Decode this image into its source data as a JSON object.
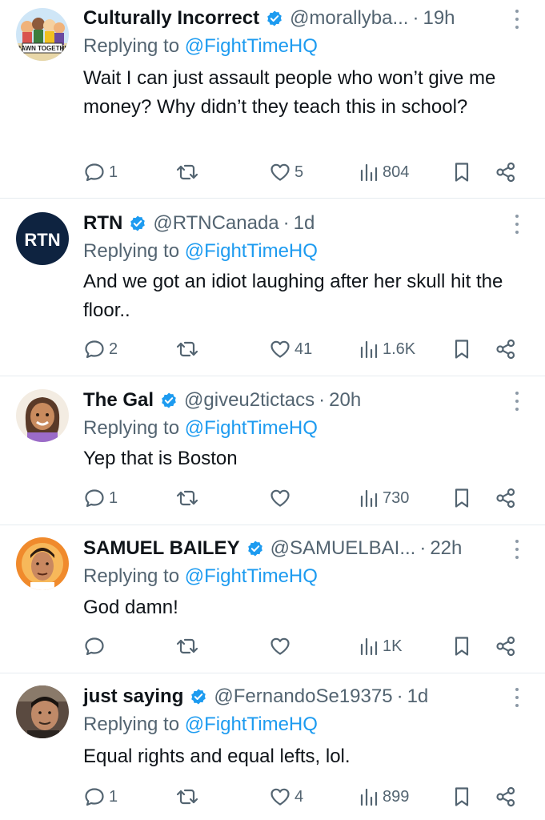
{
  "replies": [
    {
      "name": "Culturally Incorrect",
      "handle": "@morallyba...",
      "time": "19h",
      "replying_prefix": "Replying to ",
      "replying_to": "@FightTimeHQ",
      "text": "Wait I can just assault people who won’t give me money? Why didn’t they teach this in school?",
      "counts": {
        "replies": "1",
        "reposts": "",
        "likes": "5",
        "views": "804"
      },
      "avatar_text": "DRAWN TOGETHER"
    },
    {
      "name": "RTN",
      "handle": "@RTNCanada",
      "time": "1d",
      "replying_prefix": "Replying to ",
      "replying_to": "@FightTimeHQ",
      "text": "And we got an idiot laughing after her skull hit the floor..",
      "counts": {
        "replies": "2",
        "reposts": "",
        "likes": "41",
        "views": "1.6K"
      },
      "avatar_text": "RTN"
    },
    {
      "name": "The Gal",
      "handle": "@giveu2tictacs",
      "time": "20h",
      "replying_prefix": "Replying to ",
      "replying_to": "@FightTimeHQ",
      "text": "Yep that is Boston",
      "counts": {
        "replies": "1",
        "reposts": "",
        "likes": "",
        "views": "730"
      },
      "avatar_text": ""
    },
    {
      "name": "SAMUEL BAILEY",
      "handle": "@SAMUELBAI...",
      "time": "22h",
      "replying_prefix": "Replying to ",
      "replying_to": "@FightTimeHQ",
      "text": "God damn!",
      "counts": {
        "replies": "",
        "reposts": "",
        "likes": "",
        "views": "1K"
      },
      "avatar_text": ""
    },
    {
      "name": "just saying",
      "handle": "@FernandoSe19375",
      "time": "1d",
      "replying_prefix": "Replying to ",
      "replying_to": "@FightTimeHQ",
      "text": "Equal rights and equal lefts, lol.",
      "counts": {
        "replies": "1",
        "reposts": "",
        "likes": "4",
        "views": "899"
      },
      "avatar_text": ""
    }
  ],
  "colors": {
    "text_primary": "#0f1419",
    "text_secondary": "#536471",
    "link": "#1d9bf0",
    "verified_badge": "#1d9bf0",
    "divider": "#e6ecf0",
    "rtn_avatar_bg": "#0e2340"
  },
  "icons": {
    "reply": "speech-bubble-icon",
    "repost": "repost-arrows-icon",
    "like": "heart-icon",
    "views": "bar-chart-icon",
    "bookmark": "bookmark-icon",
    "share": "share-icon",
    "more": "vertical-ellipsis-icon",
    "verified": "verified-badge-icon"
  }
}
